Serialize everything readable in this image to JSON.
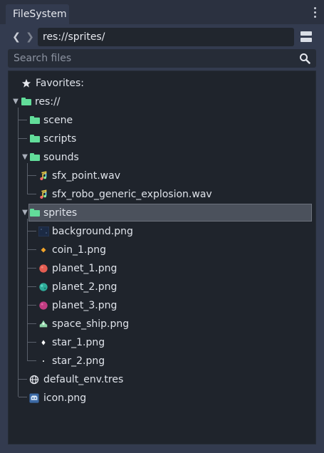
{
  "panel": {
    "tab_label": "FileSystem"
  },
  "nav": {
    "back_glyph": "❮",
    "forward_glyph": "❯",
    "path": "res://sprites/"
  },
  "search": {
    "placeholder": "Search files"
  },
  "tree": {
    "favorites_label": "Favorites:",
    "root_label": "res://",
    "items": [
      {
        "label": "scene",
        "icon": "folder-icon"
      },
      {
        "label": "scripts",
        "icon": "folder-icon"
      },
      {
        "label": "sounds",
        "icon": "folder-icon"
      },
      {
        "label": "sfx_point.wav",
        "icon": "audio-file-icon"
      },
      {
        "label": "sfx_robo_generic_explosion.wav",
        "icon": "audio-file-icon"
      },
      {
        "label": "sprites",
        "icon": "folder-icon"
      },
      {
        "label": "background.png",
        "icon": "image-thumbnail-icon"
      },
      {
        "label": "coin_1.png",
        "icon": "coin-thumbnail-icon"
      },
      {
        "label": "planet_1.png",
        "icon": "planet-red-thumbnail-icon"
      },
      {
        "label": "planet_2.png",
        "icon": "planet-teal-thumbnail-icon"
      },
      {
        "label": "planet_3.png",
        "icon": "planet-pink-thumbnail-icon"
      },
      {
        "label": "space_ship.png",
        "icon": "ship-thumbnail-icon"
      },
      {
        "label": "star_1.png",
        "icon": "star-thumbnail-icon"
      },
      {
        "label": "star_2.png",
        "icon": "star-thumbnail-icon"
      },
      {
        "label": "default_env.tres",
        "icon": "environment-icon"
      },
      {
        "label": "icon.png",
        "icon": "godot-icon"
      }
    ]
  },
  "colors": {
    "folder": "#62dd9a",
    "background": "#333b4f",
    "tree_background": "#1f242c",
    "selection": "#4b515c"
  }
}
